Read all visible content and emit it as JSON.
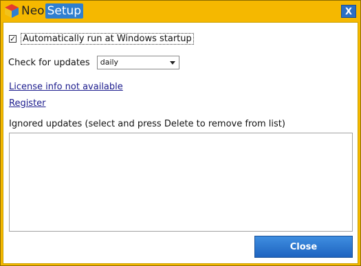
{
  "app": {
    "name_part1": "Neo",
    "name_part2": "Setup",
    "close_glyph": "X"
  },
  "settings": {
    "autorun_label": "Automatically run at Windows startup",
    "autorun_checked": true,
    "check_updates_label": "Check for updates",
    "frequency_value": "daily"
  },
  "links": {
    "license": "License info not available",
    "register": "Register"
  },
  "ignored": {
    "label": "Ignored updates (select and press Delete to remove from list)",
    "items": []
  },
  "buttons": {
    "close": "Close"
  },
  "icons": {
    "logo": "neosetup-cube-icon",
    "checkbox": "checkmark-icon",
    "dropdown": "chevron-down-icon"
  },
  "colors": {
    "frame": "#f5b800",
    "accent": "#2f7fd0",
    "link": "#1a1a8c"
  }
}
